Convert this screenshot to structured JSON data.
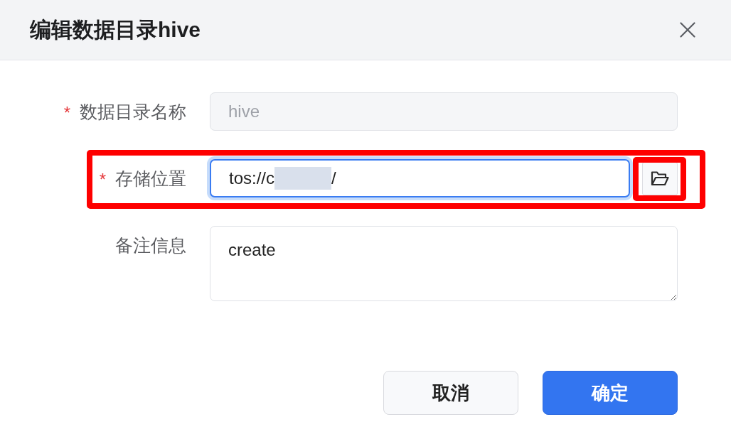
{
  "dialog": {
    "title": "编辑数据目录hive"
  },
  "form": {
    "fields": [
      {
        "kind": "text",
        "required_mark": "*",
        "label": "数据目录名称",
        "value": "hive",
        "disabled": true
      },
      {
        "kind": "path",
        "required_mark": "*",
        "label": "存储位置",
        "value_start": "tos://c",
        "redacted": true,
        "value_end": "/",
        "focused": true,
        "highlighted": true,
        "browse_button": {
          "highlighted": true
        }
      },
      {
        "kind": "textarea",
        "label": "备注信息",
        "value": "create"
      }
    ]
  },
  "buttons": [
    {
      "kind": "default",
      "label": "取消"
    },
    {
      "kind": "primary",
      "label": "确定"
    }
  ]
}
